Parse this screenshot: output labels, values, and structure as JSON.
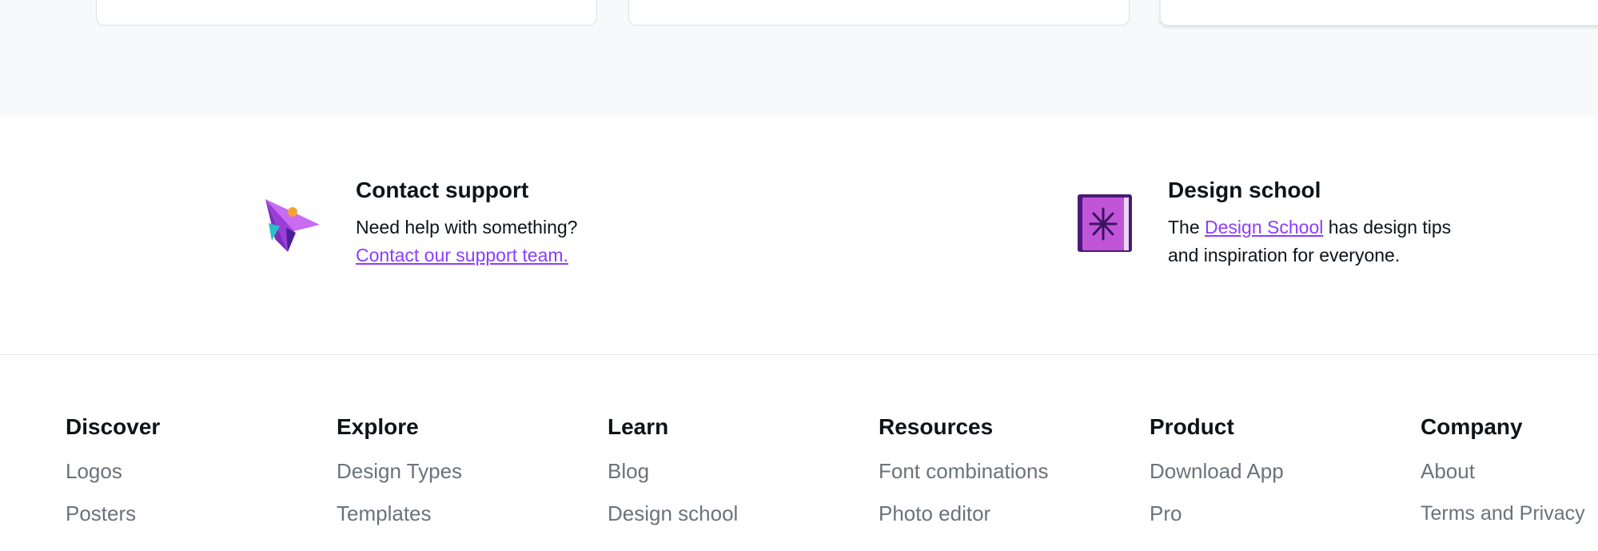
{
  "help": {
    "support": {
      "title": "Contact support",
      "text": "Need help with something?",
      "link": "Contact our support team."
    },
    "school": {
      "title": "Design school",
      "text_before": "The ",
      "link": "Design School",
      "text_after": " has design tips and inspiration for everyone."
    }
  },
  "footer": {
    "columns": [
      {
        "heading": "Discover",
        "links": [
          "Logos",
          "Posters"
        ]
      },
      {
        "heading": "Explore",
        "links": [
          "Design Types",
          "Templates"
        ]
      },
      {
        "heading": "Learn",
        "links": [
          "Blog",
          "Design school"
        ]
      },
      {
        "heading": "Resources",
        "links": [
          "Font combinations",
          "Photo editor"
        ]
      },
      {
        "heading": "Product",
        "links": [
          "Download App",
          "Pro"
        ]
      },
      {
        "heading": "Company",
        "links": [
          "About",
          "Terms and Privacy"
        ]
      }
    ]
  },
  "colors": {
    "link": "#8b3dff",
    "muted_text": "#6b7279",
    "heading": "#0e1318",
    "band": "#f8f9fa"
  },
  "icons": {
    "support": "paper-plane-icon",
    "school": "book-icon"
  }
}
